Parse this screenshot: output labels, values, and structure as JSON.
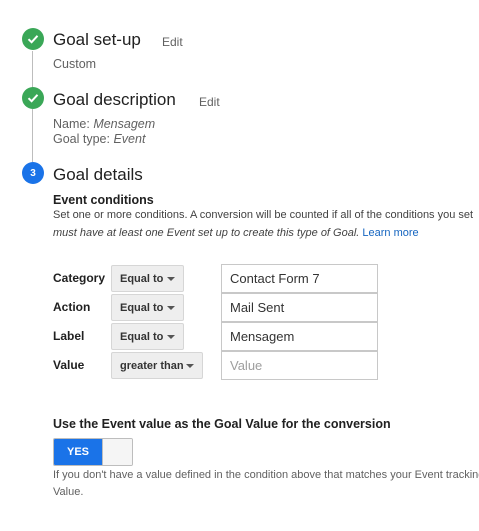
{
  "steps": [
    {
      "title": "Goal set-up",
      "edit": "Edit",
      "status": "done"
    },
    {
      "title": "Goal description",
      "edit": "Edit",
      "status": "done"
    },
    {
      "title": "Goal details",
      "number": "3",
      "status": "current"
    }
  ],
  "setup": {
    "summary": "Custom"
  },
  "description": {
    "name_label": "Name:",
    "name_value": "Mensagem",
    "type_label": "Goal type:",
    "type_value": "Event"
  },
  "details": {
    "heading": "Event conditions",
    "help_line1": "Set one or more conditions. A conversion will be counted if all of the conditions you set",
    "help_line2": "must have at least one Event set up to create this type of Goal.",
    "learn_more": "Learn more",
    "conditions": [
      {
        "label": "Category",
        "operator": "Equal to",
        "value": "Contact Form 7",
        "placeholder": ""
      },
      {
        "label": "Action",
        "operator": "Equal to",
        "value": "Mail Sent",
        "placeholder": ""
      },
      {
        "label": "Label",
        "operator": "Equal to",
        "value": "Mensagem",
        "placeholder": ""
      },
      {
        "label": "Value",
        "operator": "greater than",
        "value": "",
        "placeholder": "Value"
      }
    ],
    "use_value_heading": "Use the Event value as the Goal Value for the conversion",
    "toggle_label": "YES",
    "footnote_line1": "If you don't have a value defined in the condition above that matches your Event tracking",
    "footnote_line2": "Value."
  },
  "colors": {
    "done": "#3aa757",
    "current": "#1a73e8",
    "link": "#1565c0"
  }
}
